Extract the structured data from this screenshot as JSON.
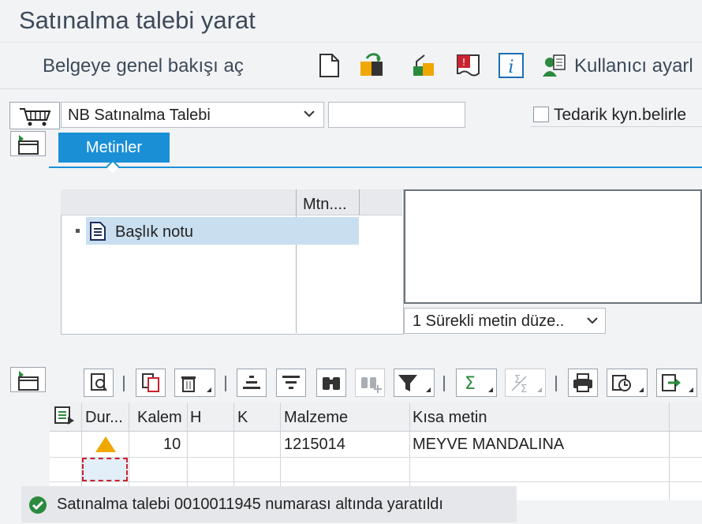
{
  "window": {
    "title": "Satınalma talebi yarat"
  },
  "toolbar": {
    "overview_label": "Belgeye genel bakışı aç",
    "settings_label": "Kullanıcı ayarl",
    "icons": [
      "new-document-icon",
      "hold-icon",
      "check-icon",
      "message-icon",
      "info-icon",
      "user-settings-icon"
    ]
  },
  "header": {
    "doc_type": "NB Satınalma Talebi",
    "doc_number": "",
    "source_checkbox_label": "Tedarik kyn.belirle",
    "source_checkbox_checked": false
  },
  "tabs": [
    {
      "label": "Metinler",
      "active": true
    }
  ],
  "texts": {
    "tree_column_header": "Mtn....",
    "tree_item": "Başlık notu",
    "text_format": "1 Sürekli metin düze..",
    "text_content": ""
  },
  "grid": {
    "columns": [
      "Dur...",
      "Kalem",
      "H",
      "K",
      "Malzeme",
      "Kısa metin"
    ],
    "rows": [
      {
        "status": "warning",
        "item": "10",
        "h": "",
        "k": "",
        "material": "1215014",
        "short_text": "MEYVE MANDALINA"
      }
    ]
  },
  "status_bar": {
    "type": "success",
    "message": "Satınalma talebi 0010011945 numarası altında yaratıldı"
  },
  "colors": {
    "accent": "#1a8fd6",
    "warning": "#f0a800",
    "success": "#2b8a3e"
  }
}
